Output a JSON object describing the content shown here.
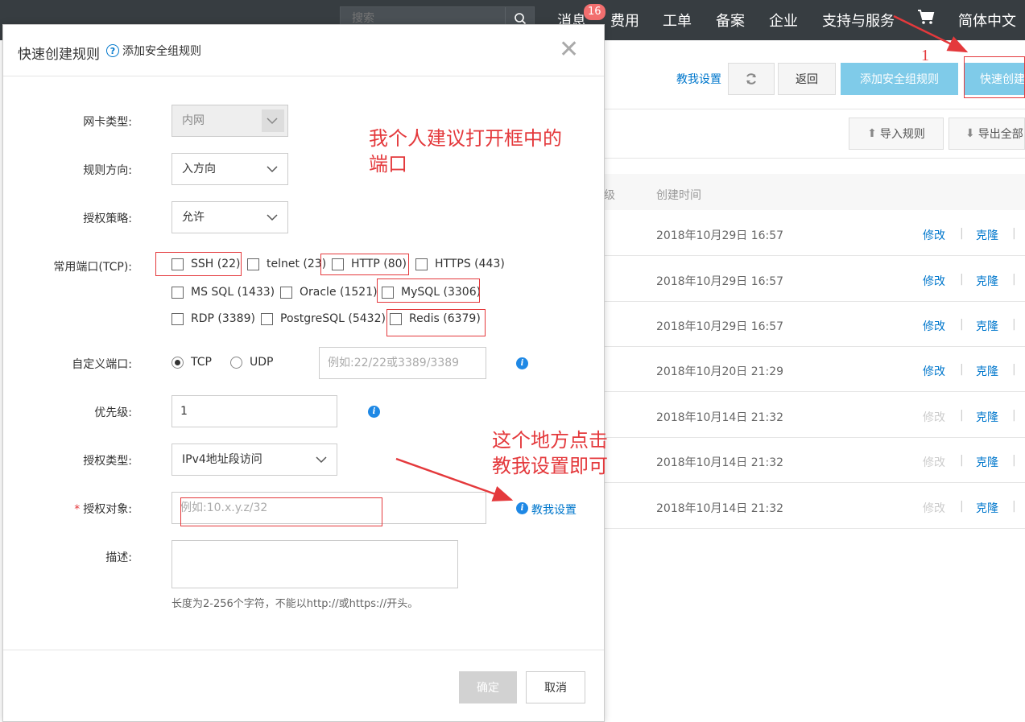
{
  "topnav": {
    "search_placeholder": "搜索",
    "items": [
      "消息",
      "费用",
      "工单",
      "备案",
      "企业",
      "支持与服务",
      "简体中文"
    ],
    "message_badge": "16"
  },
  "background": {
    "teach_label": "教我设置",
    "back_label": "返回",
    "add_rule_label": "添加安全组规则",
    "quick_create_label": "快速创建",
    "import_label": "导入规则",
    "export_label": "导出全部",
    "col_priority_partial": "级",
    "col_created": "创建时间",
    "rows": [
      {
        "time": "2018年10月29日 16:57",
        "edit": "修改",
        "clone": "克隆",
        "edit_enabled": true
      },
      {
        "time": "2018年10月29日 16:57",
        "edit": "修改",
        "clone": "克隆",
        "edit_enabled": true
      },
      {
        "time": "2018年10月29日 16:57",
        "edit": "修改",
        "clone": "克隆",
        "edit_enabled": true
      },
      {
        "time": "2018年10月20日 21:29",
        "edit": "修改",
        "clone": "克隆",
        "edit_enabled": true
      },
      {
        "time": "2018年10月14日 21:32",
        "edit": "修改",
        "clone": "克隆",
        "edit_enabled": false
      },
      {
        "time": "2018年10月14日 21:32",
        "edit": "修改",
        "clone": "克隆",
        "edit_enabled": false
      },
      {
        "time": "2018年10月14日 21:32",
        "edit": "修改",
        "clone": "克隆",
        "edit_enabled": false
      }
    ]
  },
  "modal": {
    "title": "快速创建规则",
    "help_link": "添加安全组规则",
    "nic_label": "网卡类型:",
    "nic_value": "内网",
    "direction_label": "规则方向:",
    "direction_value": "入方向",
    "policy_label": "授权策略:",
    "policy_value": "允许",
    "ports_label": "常用端口(TCP):",
    "ports": {
      "ssh": "SSH (22)",
      "telnet": "telnet (23)",
      "http": "HTTP (80)",
      "https": "HTTPS (443)",
      "mssql": "MS SQL (1433)",
      "oracle": "Oracle (1521)",
      "mysql": "MySQL (3306)",
      "rdp": "RDP (3389)",
      "postgres": "PostgreSQL (5432)",
      "redis": "Redis (6379)"
    },
    "custom_port_label": "自定义端口:",
    "tcp_label": "TCP",
    "udp_label": "UDP",
    "custom_port_placeholder": "例如:22/22或3389/3389",
    "priority_label": "优先级:",
    "priority_value": "1",
    "auth_type_label": "授权类型:",
    "auth_type_value": "IPv4地址段访问",
    "auth_object_label": "授权对象:",
    "auth_object_placeholder": "例如:10.x.y.z/32",
    "teach_label": "教我设置",
    "desc_label": "描述:",
    "desc_hint": "长度为2-256个字符，不能以http://或https://开头。",
    "ok_label": "确定",
    "cancel_label": "取消"
  },
  "annotations": {
    "ports_note": "我个人建议打开框中的\n端口",
    "teach_note": "这个地方点击\n教我设置即可",
    "step_number": "1",
    "color": "#e4393c"
  }
}
